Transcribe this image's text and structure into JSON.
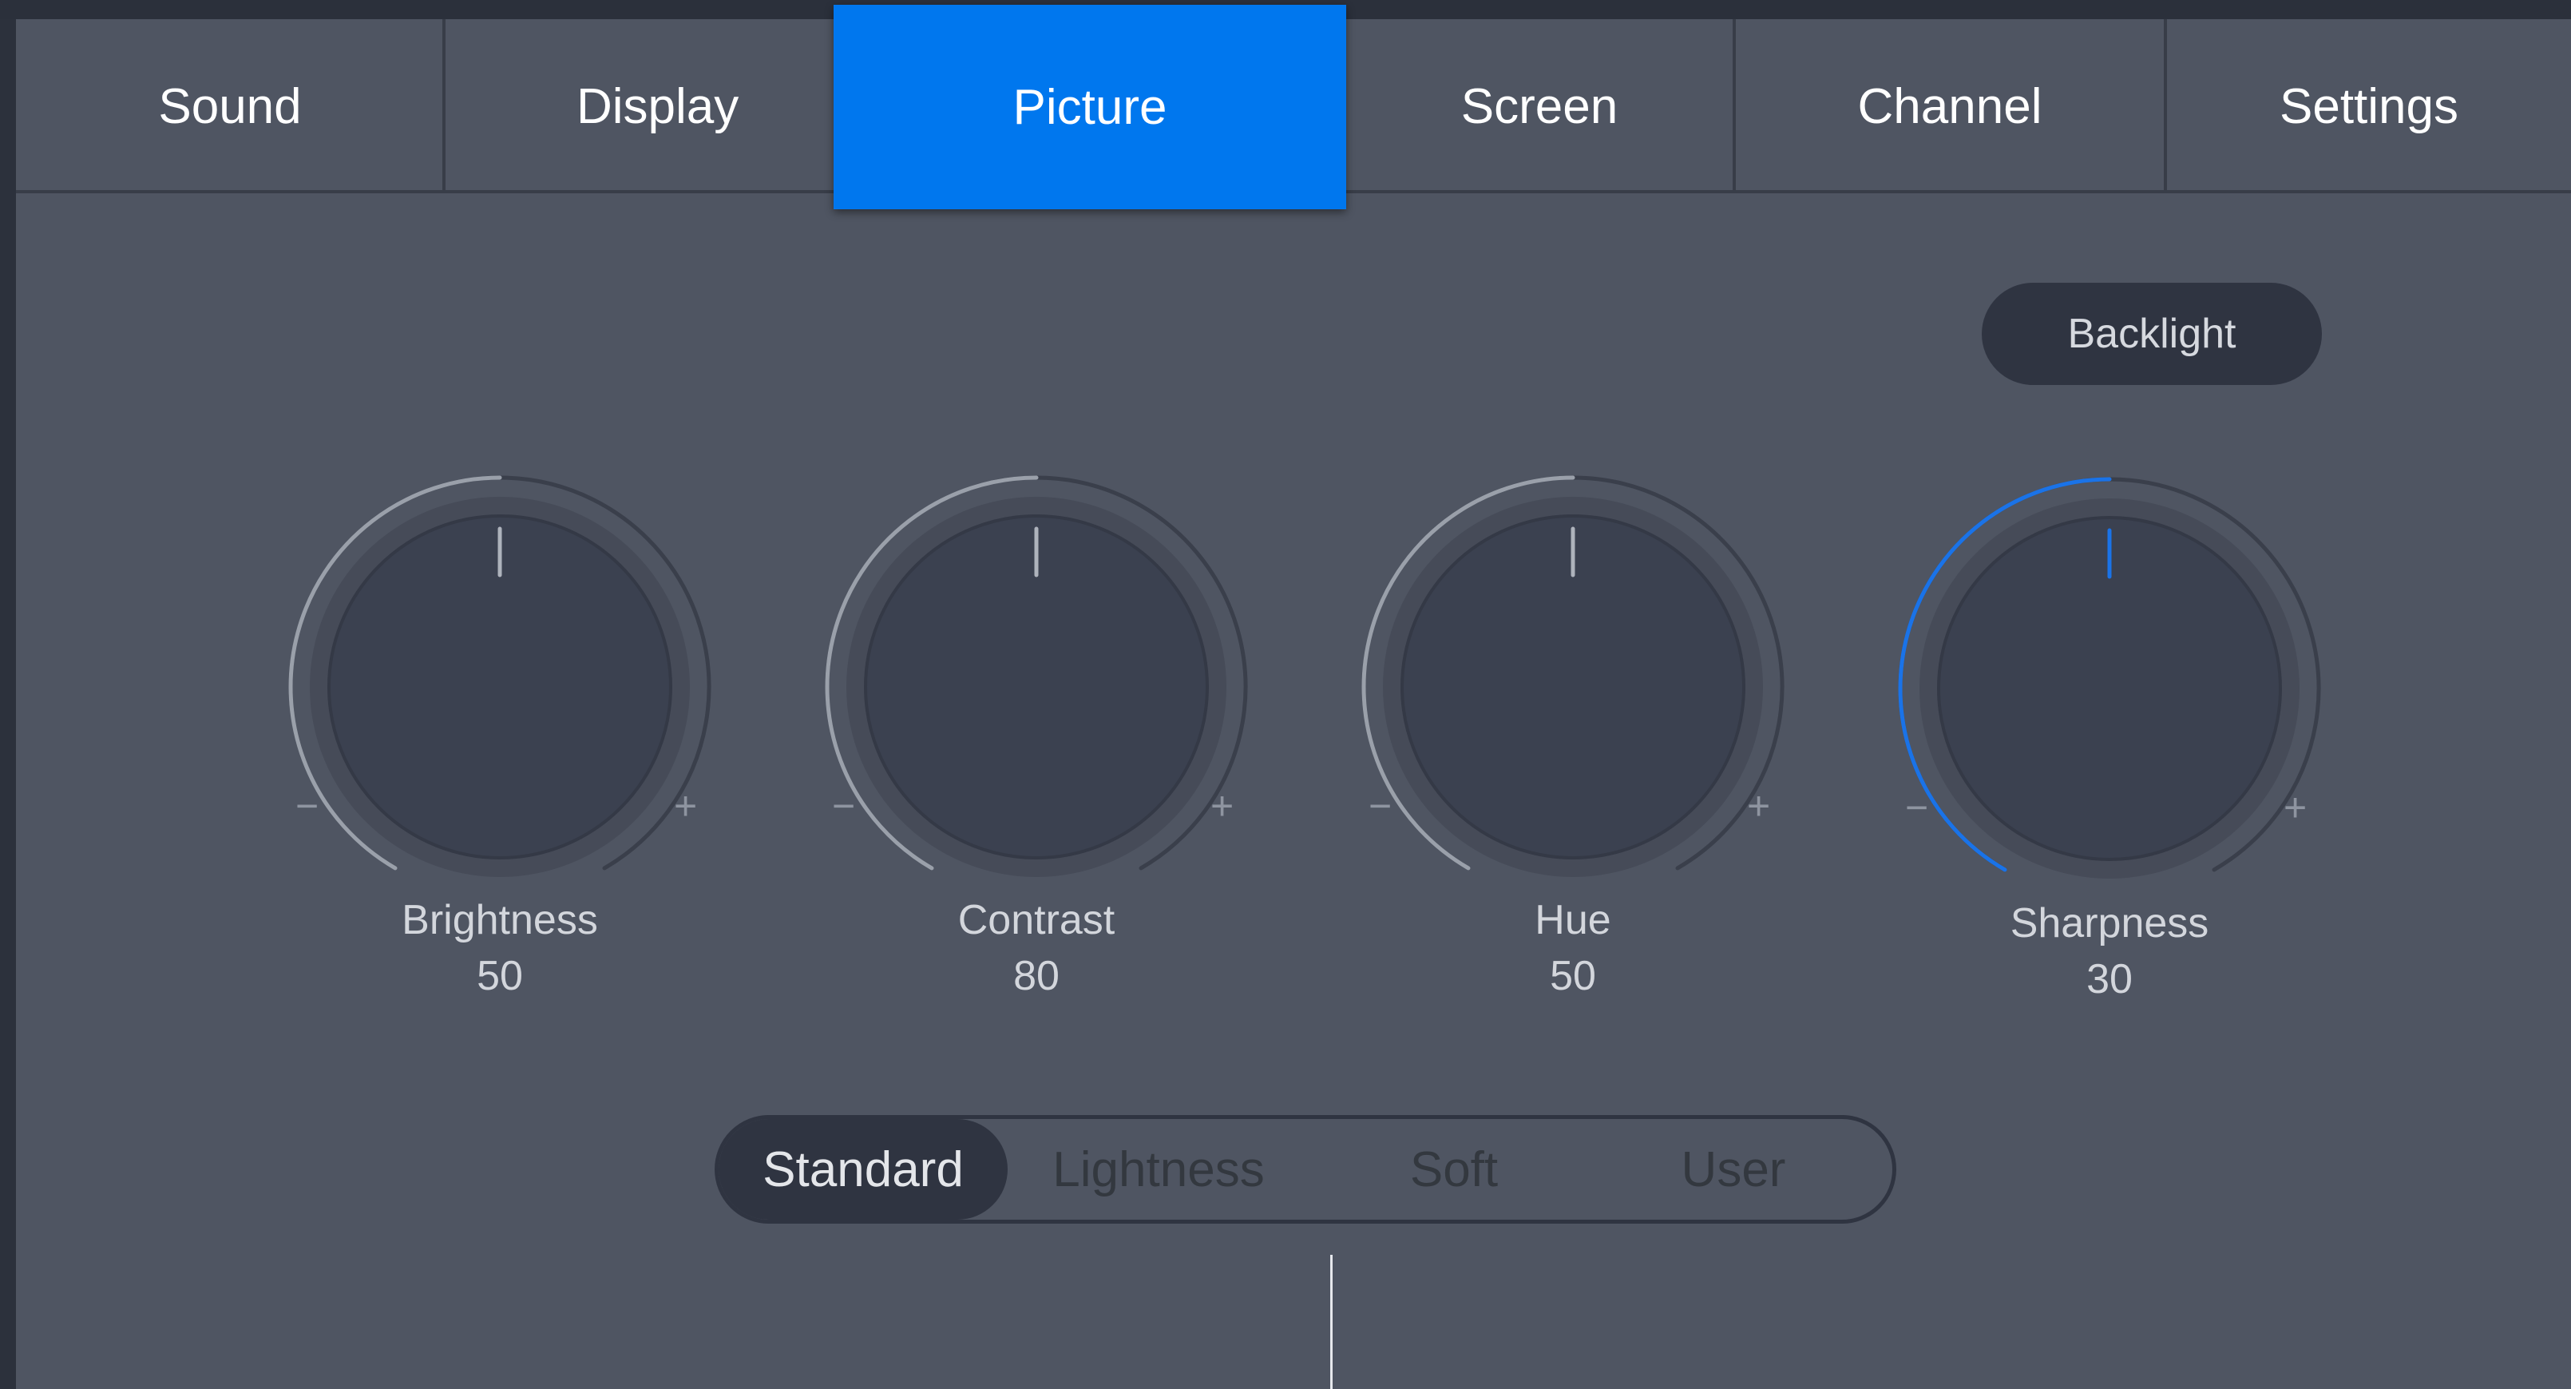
{
  "tabs": [
    {
      "label": "Sound",
      "active": false
    },
    {
      "label": "Display",
      "active": false
    },
    {
      "label": "Picture",
      "active": true
    },
    {
      "label": "Screen",
      "active": false
    },
    {
      "label": "Channel",
      "active": false
    },
    {
      "label": "Settings",
      "active": false
    }
  ],
  "backlight": {
    "label": "Backlight"
  },
  "knobs": [
    {
      "label": "Brightness",
      "value": "50",
      "level": 0.5,
      "active": false,
      "minus": "−",
      "plus": "+"
    },
    {
      "label": "Contrast",
      "value": "80",
      "level": 0.5,
      "active": false,
      "minus": "−",
      "plus": "+"
    },
    {
      "label": "Hue",
      "value": "50",
      "level": 0.5,
      "active": false,
      "minus": "−",
      "plus": "+"
    },
    {
      "label": "Sharpness",
      "value": "30",
      "level": 0.5,
      "active": true,
      "minus": "−",
      "plus": "+"
    }
  ],
  "modes": [
    {
      "label": "Standard",
      "active": true
    },
    {
      "label": "Lightness",
      "active": false
    },
    {
      "label": "Soft",
      "active": false
    },
    {
      "label": "User",
      "active": false
    }
  ],
  "colors": {
    "accent": "#0077ee",
    "panel": "#4f5562",
    "knob_track_inactive": "#9aa0aa",
    "knob_track_active": "#1a73e8"
  },
  "icons": {
    "knob_indicator": "tick-mark",
    "minus": "minus-icon",
    "plus": "plus-icon"
  }
}
